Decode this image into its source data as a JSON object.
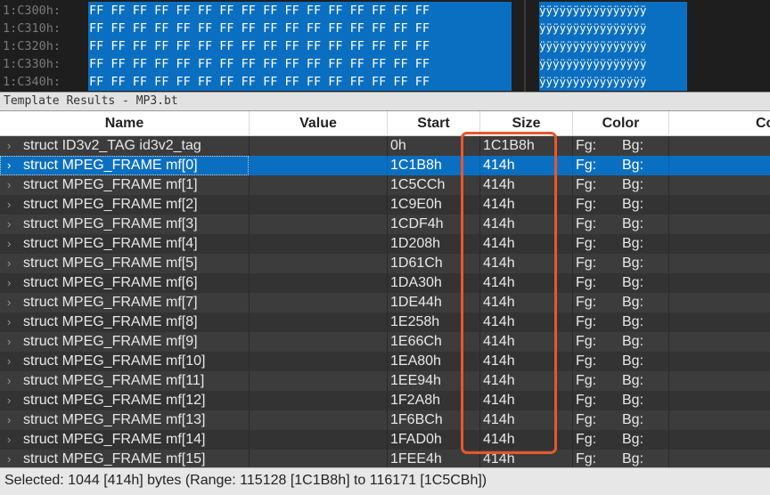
{
  "hex": {
    "rows": [
      {
        "addr": "1:C300h:",
        "bytes": "FF FF FF FF FF FF FF FF FF FF FF FF FF FF FF FF",
        "ascii": "ÿÿÿÿÿÿÿÿÿÿÿÿÿÿÿÿ"
      },
      {
        "addr": "1:C310h:",
        "bytes": "FF FF FF FF FF FF FF FF FF FF FF FF FF FF FF FF",
        "ascii": "ÿÿÿÿÿÿÿÿÿÿÿÿÿÿÿÿ"
      },
      {
        "addr": "1:C320h:",
        "bytes": "FF FF FF FF FF FF FF FF FF FF FF FF FF FF FF FF",
        "ascii": "ÿÿÿÿÿÿÿÿÿÿÿÿÿÿÿÿ"
      },
      {
        "addr": "1:C330h:",
        "bytes": "FF FF FF FF FF FF FF FF FF FF FF FF FF FF FF FF",
        "ascii": "ÿÿÿÿÿÿÿÿÿÿÿÿÿÿÿÿ"
      },
      {
        "addr": "1:C340h:",
        "bytes": "FF FF FF FF FF FF FF FF FF FF FF FF FF FF FF FF",
        "ascii": "ÿÿÿÿÿÿÿÿÿÿÿÿÿÿÿÿ"
      }
    ]
  },
  "template": {
    "title": "Template Results - MP3.bt",
    "columns": {
      "name": "Name",
      "value": "Value",
      "start": "Start",
      "size": "Size",
      "color": "Color",
      "comment": "Co"
    },
    "rows": [
      {
        "name": "struct ID3v2_TAG id3v2_tag",
        "value": "",
        "start": "0h",
        "size": "1C1B8h",
        "fg": "Fg:",
        "bg": "Bg:"
      },
      {
        "name": "struct MPEG_FRAME mf[0]",
        "value": "",
        "start": "1C1B8h",
        "size": "414h",
        "fg": "Fg:",
        "bg": "Bg:"
      },
      {
        "name": "struct MPEG_FRAME mf[1]",
        "value": "",
        "start": "1C5CCh",
        "size": "414h",
        "fg": "Fg:",
        "bg": "Bg:"
      },
      {
        "name": "struct MPEG_FRAME mf[2]",
        "value": "",
        "start": "1C9E0h",
        "size": "414h",
        "fg": "Fg:",
        "bg": "Bg:"
      },
      {
        "name": "struct MPEG_FRAME mf[3]",
        "value": "",
        "start": "1CDF4h",
        "size": "414h",
        "fg": "Fg:",
        "bg": "Bg:"
      },
      {
        "name": "struct MPEG_FRAME mf[4]",
        "value": "",
        "start": "1D208h",
        "size": "414h",
        "fg": "Fg:",
        "bg": "Bg:"
      },
      {
        "name": "struct MPEG_FRAME mf[5]",
        "value": "",
        "start": "1D61Ch",
        "size": "414h",
        "fg": "Fg:",
        "bg": "Bg:"
      },
      {
        "name": "struct MPEG_FRAME mf[6]",
        "value": "",
        "start": "1DA30h",
        "size": "414h",
        "fg": "Fg:",
        "bg": "Bg:"
      },
      {
        "name": "struct MPEG_FRAME mf[7]",
        "value": "",
        "start": "1DE44h",
        "size": "414h",
        "fg": "Fg:",
        "bg": "Bg:"
      },
      {
        "name": "struct MPEG_FRAME mf[8]",
        "value": "",
        "start": "1E258h",
        "size": "414h",
        "fg": "Fg:",
        "bg": "Bg:"
      },
      {
        "name": "struct MPEG_FRAME mf[9]",
        "value": "",
        "start": "1E66Ch",
        "size": "414h",
        "fg": "Fg:",
        "bg": "Bg:"
      },
      {
        "name": "struct MPEG_FRAME mf[10]",
        "value": "",
        "start": "1EA80h",
        "size": "414h",
        "fg": "Fg:",
        "bg": "Bg:"
      },
      {
        "name": "struct MPEG_FRAME mf[11]",
        "value": "",
        "start": "1EE94h",
        "size": "414h",
        "fg": "Fg:",
        "bg": "Bg:"
      },
      {
        "name": "struct MPEG_FRAME mf[12]",
        "value": "",
        "start": "1F2A8h",
        "size": "414h",
        "fg": "Fg:",
        "bg": "Bg:"
      },
      {
        "name": "struct MPEG_FRAME mf[13]",
        "value": "",
        "start": "1F6BCh",
        "size": "414h",
        "fg": "Fg:",
        "bg": "Bg:"
      },
      {
        "name": "struct MPEG_FRAME mf[14]",
        "value": "",
        "start": "1FAD0h",
        "size": "414h",
        "fg": "Fg:",
        "bg": "Bg:"
      },
      {
        "name": "struct MPEG_FRAME mf[15]",
        "value": "",
        "start": "1FEE4h",
        "size": "414h",
        "fg": "Fg:",
        "bg": "Bg:"
      }
    ],
    "selected_index": 1,
    "expand_icon": "chevron-right-icon"
  },
  "status": {
    "text": "Selected: 1044 [414h] bytes (Range: 115128 [1C1B8h] to 116171 [1C5CBh])"
  },
  "colors": {
    "selection": "#0b6fc1",
    "highlight_annotation": "#e8572c",
    "row_even": "#3c3c3c",
    "row_odd": "#333333"
  }
}
